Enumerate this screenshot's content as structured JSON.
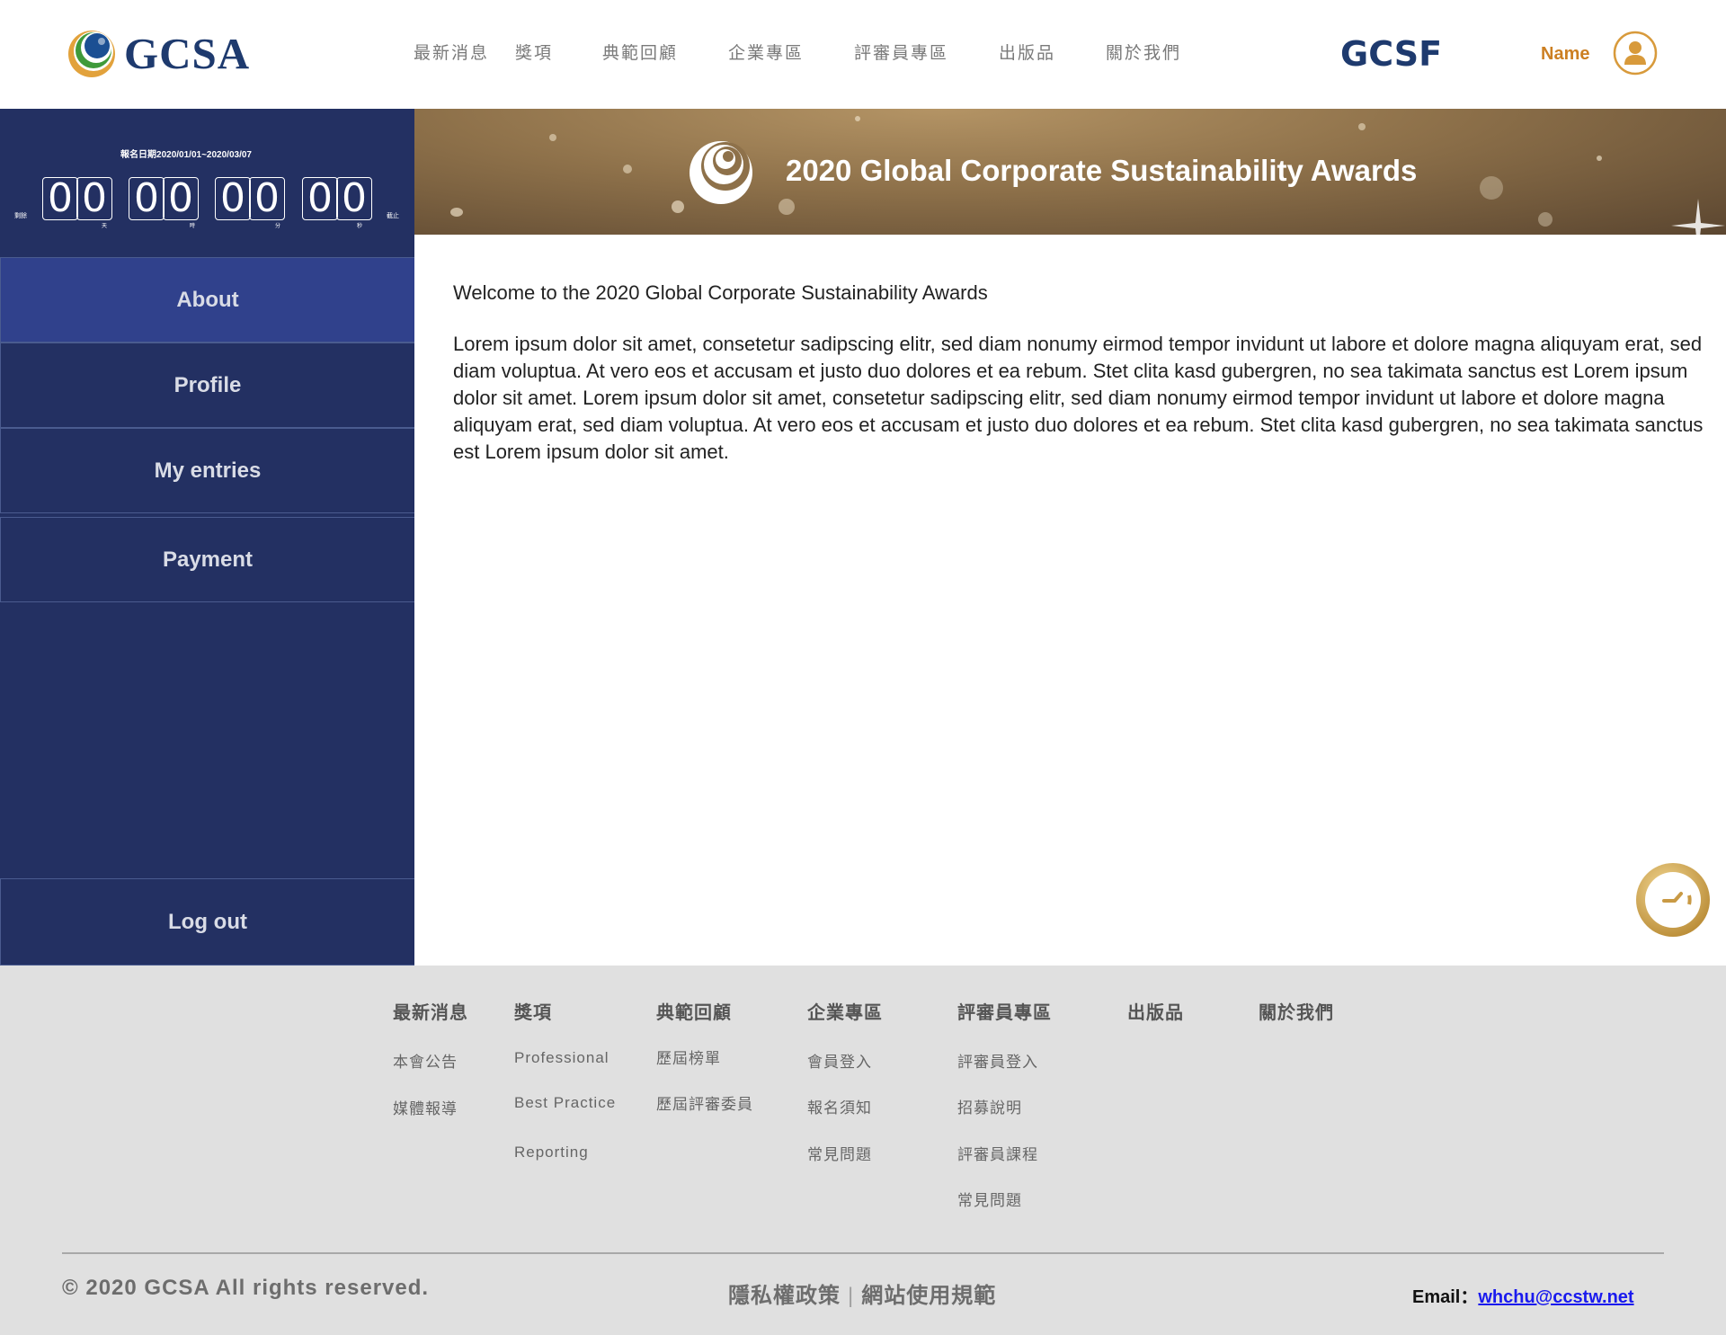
{
  "header": {
    "logo_text": "GCSA",
    "nav": [
      "最新消息",
      "獎項",
      "典範回顧",
      "企業專區",
      "評審員專區",
      "出版品",
      "關於我們"
    ],
    "partner_logo": "GCSF",
    "user_name": "Name",
    "avatar_icon": "user-avatar-icon"
  },
  "countdown": {
    "date_range": "報名日期2020/01/01~2020/03/07",
    "left_label": "剩餘",
    "right_label": "截止",
    "days": [
      "0",
      "0"
    ],
    "hours": [
      "0",
      "0"
    ],
    "minutes": [
      "0",
      "0"
    ],
    "seconds": [
      "0",
      "0"
    ],
    "units": [
      "天",
      "時",
      "分",
      "秒"
    ]
  },
  "sidebar": {
    "items": [
      "About",
      "Profile",
      "My entries",
      "Payment"
    ],
    "active": "About",
    "logout": "Log out"
  },
  "banner": {
    "title": "2020 Global Corporate Sustainability Awards"
  },
  "main": {
    "welcome": "Welcome to the 2020 Global Corporate Sustainability Awards",
    "body": "Lorem ipsum dolor sit amet, consetetur sadipscing elitr, sed diam nonumy eirmod tempor invidunt ut labore et dolore magna aliquyam erat, sed diam voluptua. At vero eos et accusam et justo duo dolores et ea rebum. Stet clita kasd gubergren, no sea takimata sanctus est Lorem ipsum dolor sit amet. Lorem ipsum dolor sit amet, consetetur sadipscing elitr, sed diam nonumy eirmod tempor invidunt ut labore et dolore magna aliquyam erat, sed diam voluptua. At vero eos et accusam et justo duo dolores et ea rebum. Stet clita kasd gubergren, no sea takimata sanctus est Lorem ipsum dolor sit amet."
  },
  "footer": {
    "columns": [
      {
        "heading": "最新消息",
        "links": [
          "本會公告",
          "媒體報導"
        ]
      },
      {
        "heading": "獎項",
        "links": [
          "Professional",
          "Best Practice",
          "Reporting"
        ]
      },
      {
        "heading": "典範回顧",
        "links": [
          "歷屆榜單",
          "歷屆評審委員"
        ]
      },
      {
        "heading": "企業專區",
        "links": [
          "會員登入",
          "報名須知",
          "常見問題"
        ]
      },
      {
        "heading": "評審員專區",
        "links": [
          "評審員登入",
          "招募說明",
          "評審員課程",
          "常見問題"
        ]
      },
      {
        "heading": "出版品",
        "links": []
      },
      {
        "heading": "關於我們",
        "links": []
      }
    ],
    "copyright": "© 2020 GCSA All rights reserved.",
    "privacy": "隱私權政策",
    "divider": "|",
    "terms": "網站使用規範",
    "email_label": "Email：",
    "email": "whchu@ccstw.net"
  },
  "colors": {
    "sidebar_bg": "#233062",
    "sidebar_active": "#30418c",
    "accent_orange": "#cc7f22",
    "brand_navy": "#1e3a6e",
    "footer_bg": "#e0e0e0"
  }
}
